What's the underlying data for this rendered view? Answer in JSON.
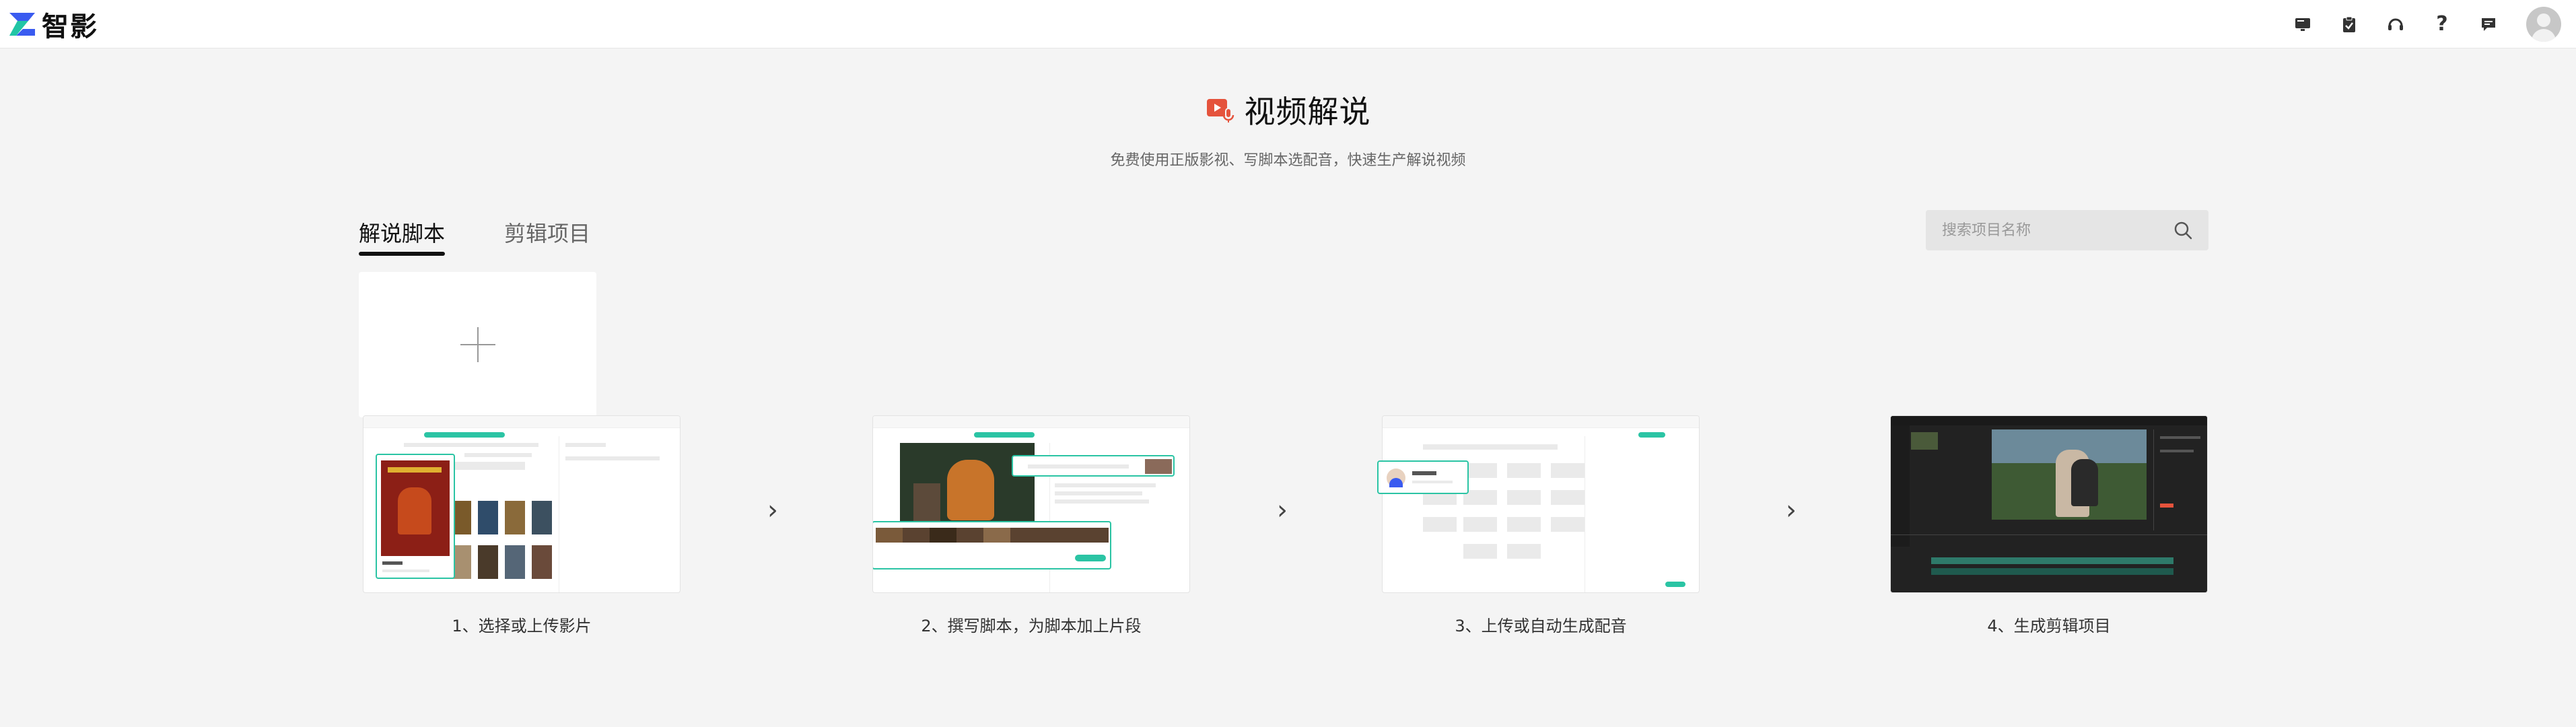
{
  "app": {
    "name": "智影"
  },
  "colors": {
    "accent": "#2bc4a4",
    "title_icon": "#e5533c"
  },
  "topbar": {
    "icons": [
      "monitor-icon",
      "clipboard-icon",
      "headset-icon",
      "help-icon",
      "message-icon"
    ],
    "help_glyph": "?"
  },
  "header": {
    "title": "视频解说",
    "subtitle": "免费使用正版影视、写脚本选配音，快速生产解说视频"
  },
  "tabs": [
    {
      "label": "解说脚本",
      "active": true
    },
    {
      "label": "剪辑项目",
      "active": false
    }
  ],
  "search": {
    "placeholder": "搜索项目名称"
  },
  "steps": [
    {
      "label": "1、选择或上传影片"
    },
    {
      "label": "2、撰写脚本，为脚本加上片段"
    },
    {
      "label": "3、上传或自动生成配音"
    },
    {
      "label": "4、生成剪辑项目"
    }
  ],
  "arrow_glyph": "›"
}
